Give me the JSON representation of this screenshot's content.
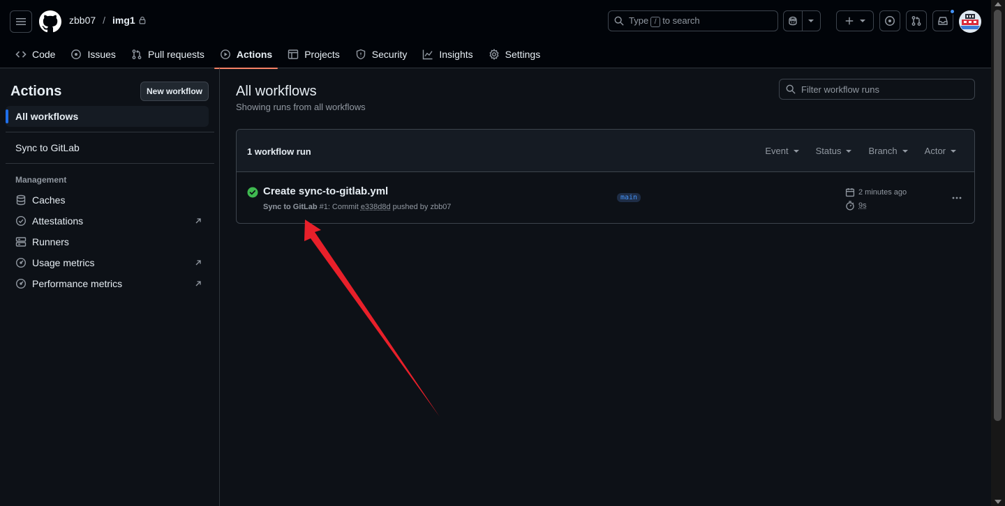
{
  "header": {
    "owner": "zbb07",
    "separator": "/",
    "repo": "img1",
    "search": {
      "prefix": "Type",
      "key": "/",
      "suffix": "to search"
    }
  },
  "repo_nav": [
    {
      "label": "Code",
      "icon": "code-icon"
    },
    {
      "label": "Issues",
      "icon": "issue-icon"
    },
    {
      "label": "Pull requests",
      "icon": "pull-request-icon"
    },
    {
      "label": "Actions",
      "icon": "play-icon",
      "active": true
    },
    {
      "label": "Projects",
      "icon": "table-icon"
    },
    {
      "label": "Security",
      "icon": "shield-icon"
    },
    {
      "label": "Insights",
      "icon": "graph-icon"
    },
    {
      "label": "Settings",
      "icon": "gear-icon"
    }
  ],
  "sidebar": {
    "title": "Actions",
    "new_workflow_label": "New workflow",
    "all_workflows": "All workflows",
    "workflows": [
      "Sync to GitLab"
    ],
    "management_heading": "Management",
    "management": [
      {
        "label": "Caches",
        "icon": "database-icon"
      },
      {
        "label": "Attestations",
        "icon": "verified-icon",
        "external": true
      },
      {
        "label": "Runners",
        "icon": "server-icon"
      },
      {
        "label": "Usage metrics",
        "icon": "meter-icon",
        "external": true
      },
      {
        "label": "Performance metrics",
        "icon": "meter-icon",
        "external": true
      }
    ]
  },
  "main": {
    "title": "All workflows",
    "subtitle": "Showing runs from all workflows",
    "filter_placeholder": "Filter workflow runs",
    "runs_count": "1 workflow run",
    "filters": [
      "Event",
      "Status",
      "Branch",
      "Actor"
    ],
    "run": {
      "title": "Create sync-to-gitlab.yml",
      "workflow": "Sync to GitLab",
      "number": "#1:",
      "commit_prefix": "Commit",
      "sha": "e338d8d",
      "pushed_by": "pushed by zbb07",
      "branch": "main",
      "time_ago": "2 minutes ago",
      "duration": "9s",
      "status": "success"
    }
  },
  "colors": {
    "bg": "#0d1117",
    "header_bg": "#010409",
    "accent_underline": "#f78166",
    "success": "#3fb950",
    "link": "#4493f8",
    "annotation_arrow": "#e8202a"
  }
}
